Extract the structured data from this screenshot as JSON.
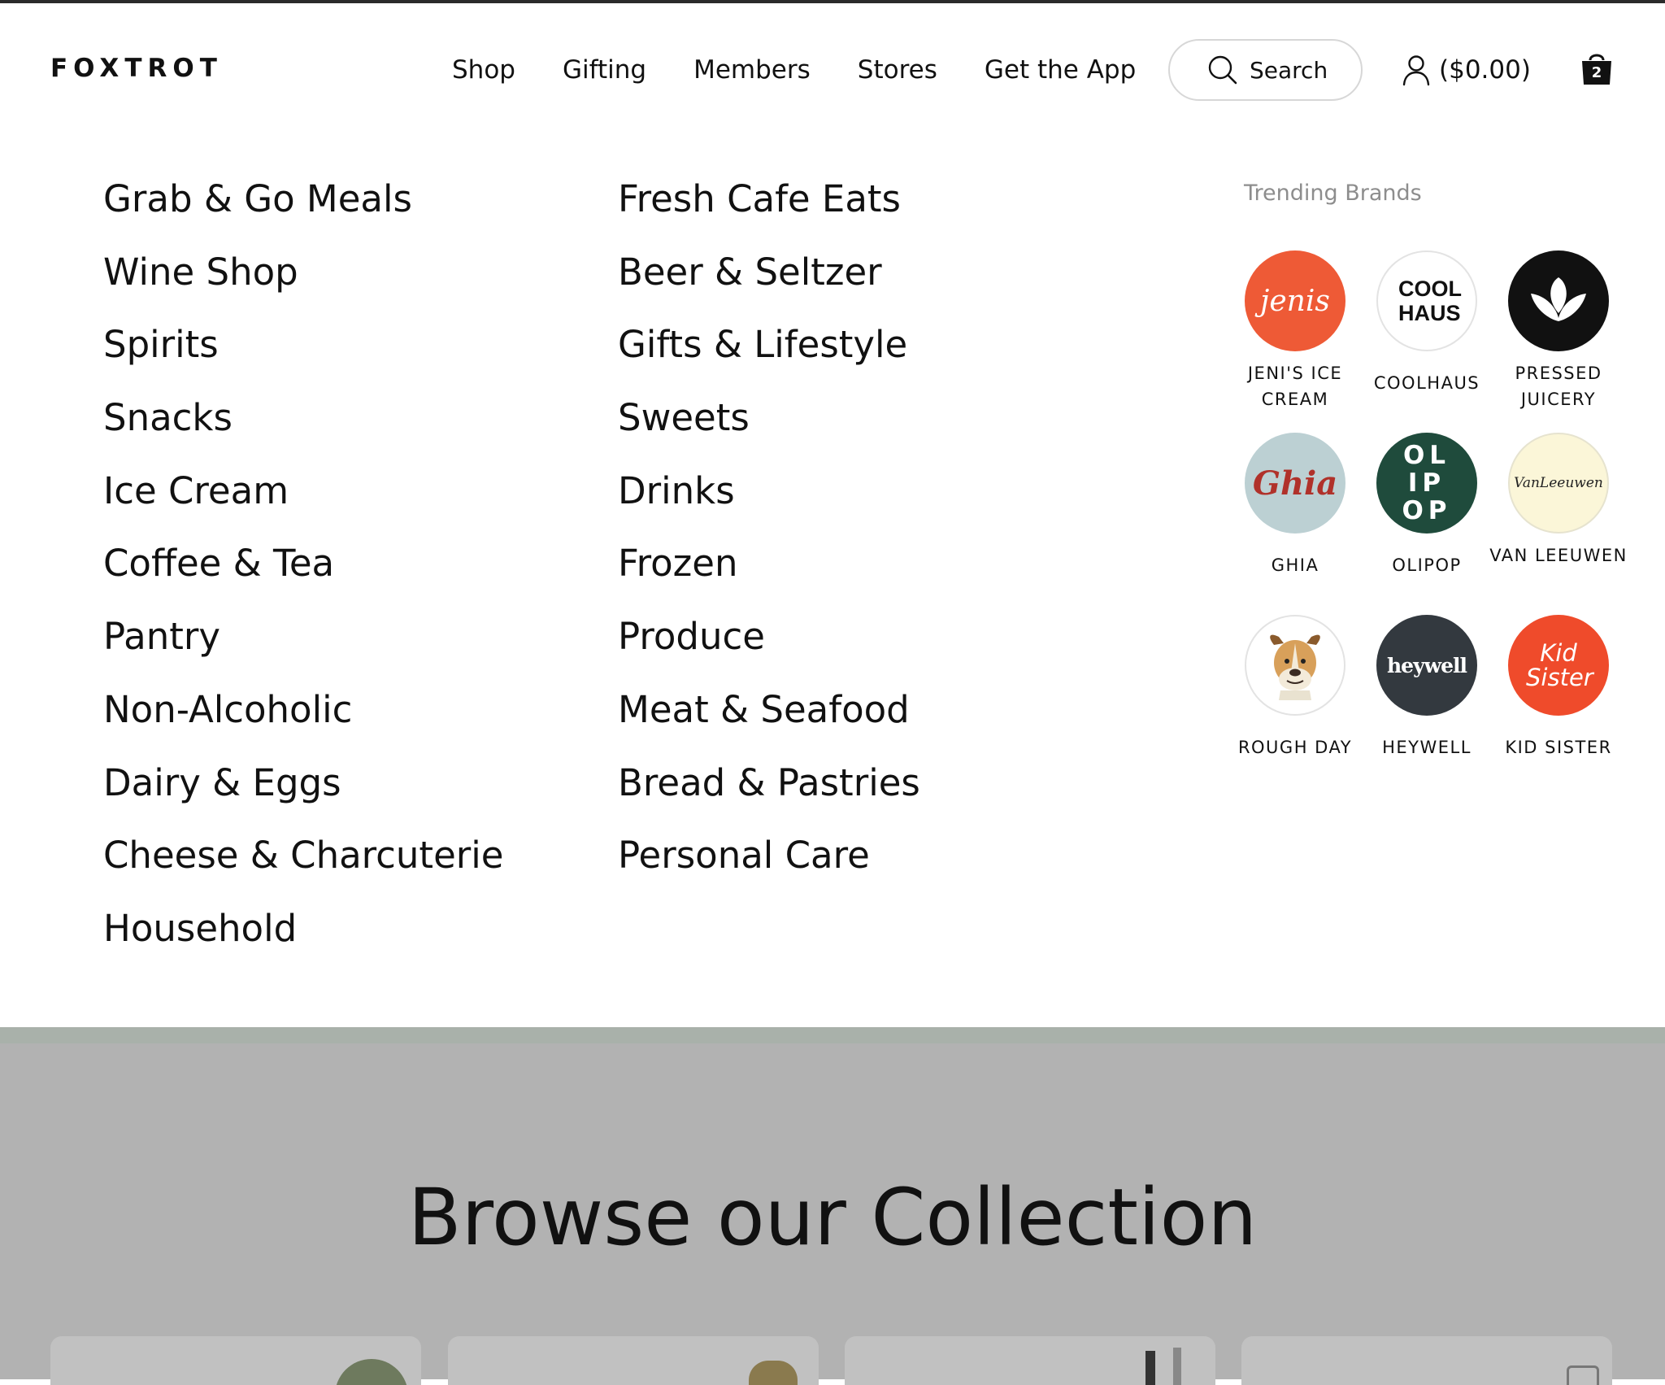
{
  "header": {
    "logo": "FOXTROT",
    "nav": [
      "Shop",
      "Gifting",
      "Members",
      "Stores",
      "Get the App"
    ],
    "search_label": "Search",
    "balance": "($0.00)",
    "cart_count": "2"
  },
  "menu": {
    "col_a": [
      "Grab & Go Meals",
      "Wine Shop",
      "Spirits",
      "Snacks",
      "Ice Cream",
      "Coffee & Tea",
      "Pantry",
      "Non-Alcoholic",
      "Dairy & Eggs",
      "Cheese & Charcuterie",
      "Household"
    ],
    "col_b": [
      "Fresh Cafe Eats",
      "Beer & Seltzer",
      "Gifts & Lifestyle",
      "Sweets",
      "Drinks",
      "Frozen",
      "Produce",
      "Meat & Seafood",
      "Bread & Pastries",
      "Personal Care"
    ]
  },
  "trending": {
    "title": "Trending Brands",
    "brands": [
      {
        "name": "JENI'S ICE CREAM",
        "logo_text": "jenis",
        "bg": "#ee5a36",
        "fg": "#ffffff"
      },
      {
        "name": "COOLHAUS",
        "logo_text": "COOL HAUS",
        "bg": "#ffffff",
        "fg": "#111111"
      },
      {
        "name": "PRESSED JUICERY",
        "logo_text": "",
        "bg": "#111111",
        "fg": "#ffffff"
      },
      {
        "name": "GHIA",
        "logo_text": "Ghia",
        "bg": "#bcd0d3",
        "fg": "#b0312a"
      },
      {
        "name": "OLIPOP",
        "logo_text": "OLIPOP",
        "bg": "#1f4b3c",
        "fg": "#ffffff"
      },
      {
        "name": "VAN LEEUWEN",
        "logo_text": "VanLeeuwen",
        "bg": "#fbf6d8",
        "fg": "#222222"
      },
      {
        "name": "ROUGH DAY",
        "logo_text": "",
        "bg": "#ffffff",
        "fg": "#111111"
      },
      {
        "name": "HEYWELL",
        "logo_text": "heywell",
        "bg": "#33393f",
        "fg": "#ffffff"
      },
      {
        "name": "KID SISTER",
        "logo_text": "Kid Sister",
        "bg": "#ef4b2b",
        "fg": "#ffffff"
      }
    ]
  },
  "collection": {
    "title": "Browse our Collection"
  }
}
